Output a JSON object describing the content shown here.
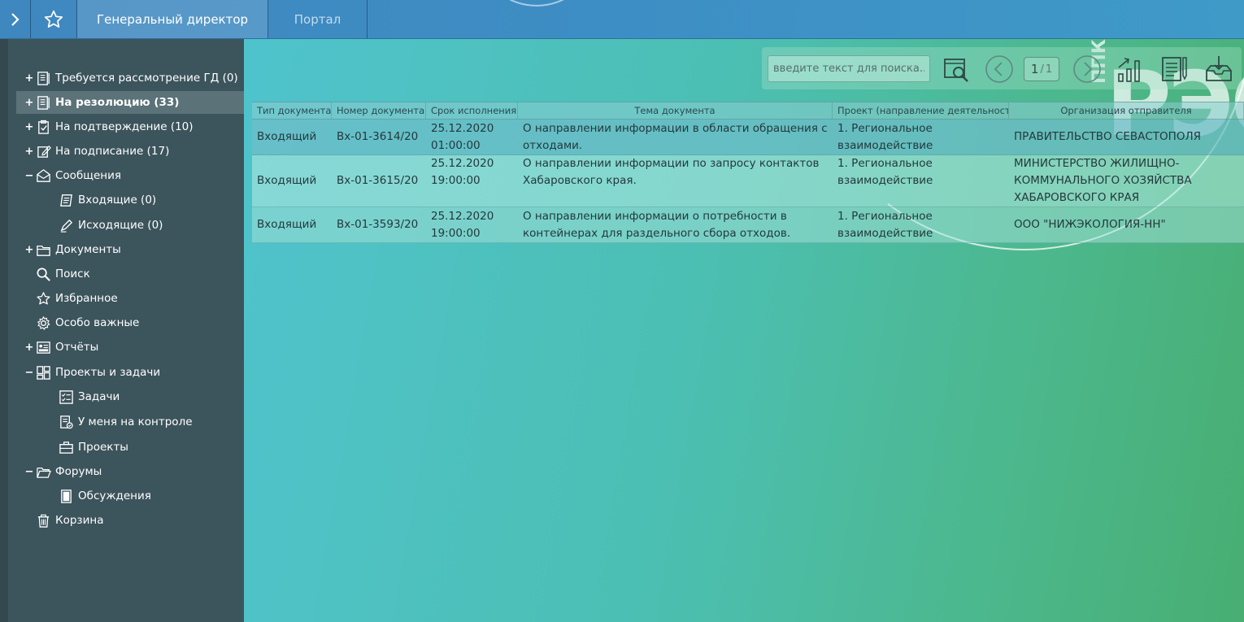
{
  "topbar": {
    "expand_icon": "chevron-right-icon",
    "favorite_icon": "star-icon",
    "tabs": [
      {
        "label": "Генеральный директор",
        "active": true
      },
      {
        "label": "Портал",
        "active": false
      }
    ]
  },
  "sidebar": {
    "items": [
      {
        "toggle": "+",
        "icon": "document-list-icon",
        "label": "Требуется рассмотрение ГД (0)",
        "level": 0
      },
      {
        "toggle": "+",
        "icon": "document-list-icon",
        "label": "На резолюцию (33)",
        "level": 0,
        "selected": true
      },
      {
        "toggle": "+",
        "icon": "clipboard-check-icon",
        "label": "На подтверждение (10)",
        "level": 0
      },
      {
        "toggle": "+",
        "icon": "edit-icon",
        "label": "На подписание (17)",
        "level": 0
      },
      {
        "toggle": "−",
        "icon": "envelope-open-icon",
        "label": "Сообщения",
        "level": 0
      },
      {
        "toggle": "",
        "icon": "inbox-doc-icon",
        "label": "Входящие (0)",
        "level": 1
      },
      {
        "toggle": "",
        "icon": "pen-icon",
        "label": "Исходящие (0)",
        "level": 1
      },
      {
        "toggle": "+",
        "icon": "folder-icon",
        "label": "Документы",
        "level": 0
      },
      {
        "toggle": "",
        "icon": "search-icon",
        "label": "Поиск",
        "level": 0
      },
      {
        "toggle": "",
        "icon": "star-icon",
        "label": "Избранное",
        "level": 0
      },
      {
        "toggle": "",
        "icon": "gear-icon",
        "label": "Особо важные",
        "level": 0
      },
      {
        "toggle": "+",
        "icon": "report-icon",
        "label": "Отчёты",
        "level": 0
      },
      {
        "toggle": "−",
        "icon": "dashboard-icon",
        "label": "Проекты и задачи",
        "level": 0
      },
      {
        "toggle": "",
        "icon": "checklist-icon",
        "label": "Задачи",
        "level": 1
      },
      {
        "toggle": "",
        "icon": "control-icon",
        "label": "У меня на контроле",
        "level": 1
      },
      {
        "toggle": "",
        "icon": "briefcase-icon",
        "label": "Проекты",
        "level": 1
      },
      {
        "toggle": "−",
        "icon": "folder-open-icon",
        "label": "Форумы",
        "level": 0
      },
      {
        "toggle": "",
        "icon": "discussion-icon",
        "label": "Обсуждения",
        "level": 1
      },
      {
        "toggle": "",
        "icon": "trash-icon",
        "label": "Корзина",
        "level": 0
      }
    ]
  },
  "toolbar": {
    "search_placeholder": "введите текст для поиска...",
    "page_current": "1",
    "page_separator": "/",
    "page_total": "1",
    "icons": [
      "search-document-icon",
      "previous-page-icon",
      "next-page-icon",
      "chart-icon",
      "edit-document-icon",
      "export-icon"
    ]
  },
  "logo": {
    "text": "РЭО",
    "sub": "ППК"
  },
  "table": {
    "columns": [
      "Тип документа",
      "Номер документа",
      "Срок исполнения",
      "Тема документа",
      "Проект (направление деятельности)",
      "Организация отправителя"
    ],
    "rows": [
      {
        "type": "Входящий",
        "number": "Вх-01-3614/20",
        "deadline_date": "25.12.2020",
        "deadline_time": "01:00:00",
        "subject": "О направлении информации в области обращения с отходами.",
        "project": "1. Региональное взаимодействие",
        "sender": "ПРАВИТЕЛЬСТВО СЕВАСТОПОЛЯ"
      },
      {
        "type": "Входящий",
        "number": "Вх-01-3615/20",
        "deadline_date": "25.12.2020",
        "deadline_time": "19:00:00",
        "subject": "О направлении информации по запросу контактов Хабаровского края.",
        "project": "1. Региональное взаимодействие",
        "sender": "МИНИСТЕРСТВО ЖИЛИЩНО-КОММУНАЛЬНОГО ХОЗЯЙСТВА ХАБАРОВСКОГО КРАЯ"
      },
      {
        "type": "Входящий",
        "number": "Вх-01-3593/20",
        "deadline_date": "25.12.2020",
        "deadline_time": "19:00:00",
        "subject": "О направлении информации о потребности в контейнерах для раздельного сбора отходов.",
        "project": "1. Региональное взаимодействие",
        "sender": "ООО \"НИЖЭКОЛОГИЯ-НН\""
      }
    ]
  }
}
